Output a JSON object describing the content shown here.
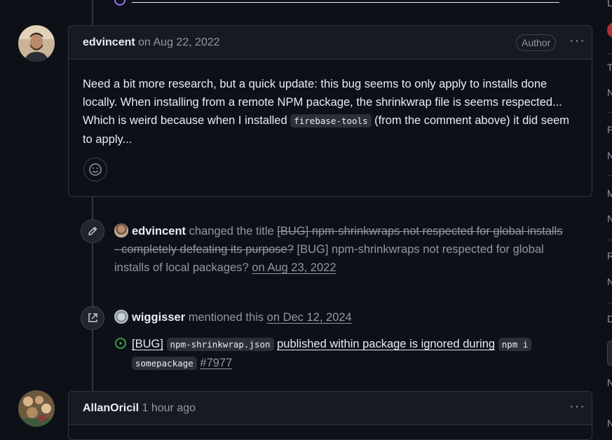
{
  "top_fragment": {
    "text": ""
  },
  "comment1": {
    "author": "edvincent",
    "date": "on Aug 22, 2022",
    "badge": "Author",
    "more": "···",
    "body_part1": "Need a bit more research, but a quick update: this bug seems to only apply to installs done locally. When installing from a remote NPM package, the shrinkwrap file is seems respected... Which is weird because when I installed ",
    "body_code": "firebase-tools",
    "body_part2": " (from the comment above) it did seem to apply..."
  },
  "event_rename": {
    "actor": "edvincent",
    "action": "changed the title",
    "old_title": "[BUG] npm-shrinkwraps not respected for global installs - completely defeating its purpose?",
    "new_title": "[BUG] npm-shrinkwraps not respected for global installs of local packages?",
    "date": "on Aug 23, 2022"
  },
  "event_mention": {
    "actor": "wiggisser",
    "action": "mentioned this",
    "date": "on Dec 12, 2024",
    "ref_prefix": "[BUG]",
    "ref_code1": "npm-shrinkwrap.json",
    "ref_middle": "published within package is ignored during",
    "ref_code2a": "npm i",
    "ref_code2b": "somepackage",
    "ref_number": "#7977"
  },
  "comment2": {
    "author": "AllanOricil",
    "date": "1 hour ago",
    "more": "···"
  },
  "sidebar": {
    "letters": [
      "L",
      "T",
      "N",
      "P",
      "N",
      "M",
      "N",
      "R",
      "N",
      "D",
      "N",
      "N"
    ]
  },
  "colors": {
    "background": "#0d1117",
    "header_bg": "#161b22",
    "border": "#30363d",
    "muted": "#9198a1",
    "open_green": "#3fb950"
  }
}
